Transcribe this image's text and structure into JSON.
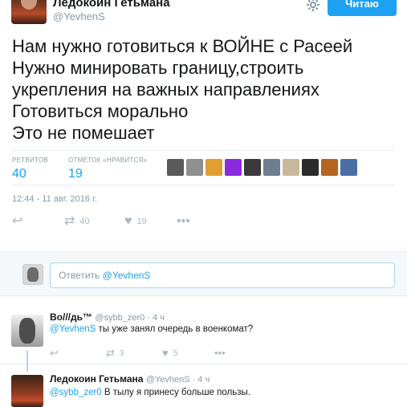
{
  "author": {
    "name": "Ледокоин Гетьмана",
    "handle": "@YevhenS"
  },
  "follow_button": {
    "label": "Читаю"
  },
  "tweet": {
    "lines": [
      "Нам нужно готовиться к ВОЙНЕ с Расеей",
      "Нужно минировать границу,строить",
      "укрепления на важных направлениях",
      "Готовиться морально",
      "Это не помешает"
    ],
    "timestamp": "12:44 - 11 авг. 2016 г."
  },
  "stats": {
    "retweets_label": "РЕТВИТОВ",
    "retweets_value": "40",
    "likes_label": "ОТМЕТОК «НРАВИТСЯ»",
    "likes_value": "19",
    "liker_colors": [
      "#5a5a5a",
      "#8f8f8f",
      "#e0a030",
      "#8a2be2",
      "#3a3a3a",
      "#6e7f8f",
      "#c8b89a",
      "#2b2b2b",
      "#b5651d",
      "#4a6fa5"
    ]
  },
  "actions": {
    "reply_icon": "reply-icon",
    "retweet_count": "40",
    "like_count": "19",
    "more": "•••"
  },
  "reply_box": {
    "prefix": "Ответить",
    "mention": "@YevhenS"
  },
  "replies": [
    {
      "name": "Во///дь™",
      "meta": "@sybb_zer0 · 4 ч",
      "mention": "@YevhenS",
      "text": " ты уже занял очередь в военкомат?",
      "retweet_count": "3",
      "like_count": "5",
      "more": "•••"
    },
    {
      "name": "Ледокоин Гетьмана",
      "meta": "@YevhenS · 4 ч",
      "mention": "@sybb_zer0",
      "text": " В тылу я принесу больше пользы."
    }
  ],
  "colors": {
    "accent": "#1da1f2",
    "muted": "#8899a6",
    "icon_muted": "#aab8c2",
    "divider": "#e6ecf0"
  }
}
